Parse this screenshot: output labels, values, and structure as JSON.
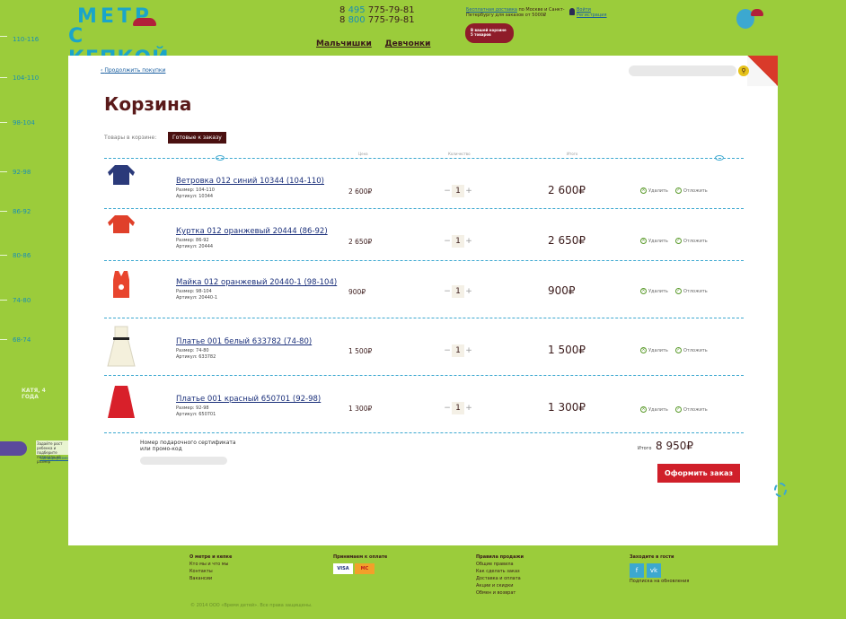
{
  "ruler": {
    "sizes": [
      "110-116",
      "104-110",
      "98-104",
      "92-98",
      "86-92",
      "80-86",
      "74-80",
      "68-74"
    ],
    "kate_label": "КАТЯ, 4 ГОДА",
    "side_note": "Задайте рост ребенка и подберите подходящий размер",
    "side_link": "Таблица размеров"
  },
  "header": {
    "logo_line1": "МЕТР",
    "logo_line2": "С КЕПКОЙ",
    "phone1_prefix": "8",
    "phone1_code": "495",
    "phone1_number": "775-79-81",
    "phone2_prefix": "8",
    "phone2_code": "800",
    "phone2_number": "775-79-81",
    "nav": [
      "Мальчишки",
      "Девчонки"
    ],
    "delivery_link": "Бесплатная доставка",
    "delivery_text": "по Москве и Санкт-Петербургу для заказов от 5000₽",
    "hat_badge": "В вашей корзине 5 товаров",
    "login": "Войти",
    "register": "Регистрация"
  },
  "main": {
    "back_link": "Продолжить покупки",
    "search_placeholder": "",
    "search_icon": "search-icon",
    "title": "Корзина",
    "cart_label": "Товары в корзине:",
    "cart_badge": "Готовые к заказу",
    "columns": {
      "price": "Цена",
      "qty": "Количество",
      "total": "Итого"
    },
    "items": [
      {
        "name": "Ветровка 012 синий 10344 (104-110)",
        "size": "Размер: 104-110",
        "sku": "Артикул: 10344",
        "price": "2 600₽",
        "qty": "1",
        "total": "2 600₽",
        "color": "#2b3a7a",
        "icon": "jacket-icon"
      },
      {
        "name": "Куртка 012 оранжевый 20444 (86-92)",
        "size": "Размер: 86-92",
        "sku": "Артикул: 20444",
        "price": "2 650₽",
        "qty": "1",
        "total": "2 650₽",
        "color": "#e0402a",
        "icon": "jacket-icon"
      },
      {
        "name": "Майка 012 оранжевый 20440-1 (98-104)",
        "size": "Размер: 98-104",
        "sku": "Артикул: 20440-1",
        "price": "900₽",
        "qty": "1",
        "total": "900₽",
        "color": "#e8452e",
        "icon": "tank-top-icon"
      },
      {
        "name": "Платье 001 белый 633782 (74-80)",
        "size": "Размер: 74-80",
        "sku": "Артикул: 633782",
        "price": "1 500₽",
        "qty": "1",
        "total": "1 500₽",
        "color": "#f4f0dc",
        "icon": "dress-icon"
      },
      {
        "name": "Платье 001 красный 650701 (92-98)",
        "size": "Размер: 92-98",
        "sku": "Артикул: 650701",
        "price": "1 300₽",
        "qty": "1",
        "total": "1 300₽",
        "color": "#d8202a",
        "icon": "dress-icon"
      }
    ],
    "delete_label": "Удалить",
    "postpone_label": "Отложить",
    "promo_label": "Номер подарочного сертификата или промо-код",
    "sum_label": "Итого",
    "sum_value": "8 950₽",
    "order_button": "Оформить заказ"
  },
  "footer": {
    "col1": {
      "title": "О метре и кепке",
      "links": [
        "Кто мы и что мы",
        "Контакты",
        "Вакансии"
      ]
    },
    "col2": {
      "title": "Принимаем к оплате",
      "visa": "VISA",
      "mastercard": "MC"
    },
    "col3": {
      "title": "Правила продажи",
      "links": [
        "Общие правила",
        "Как сделать заказ",
        "Доставка и оплата",
        "Акции и скидки",
        "Обмен и возврат"
      ]
    },
    "col4": {
      "title": "Заходите в гости",
      "fb": "f",
      "vk": "vk",
      "subscribe": "Подписка на обновления"
    },
    "copyright": "© 2014 ООО «Время детей». Все права защищены."
  }
}
